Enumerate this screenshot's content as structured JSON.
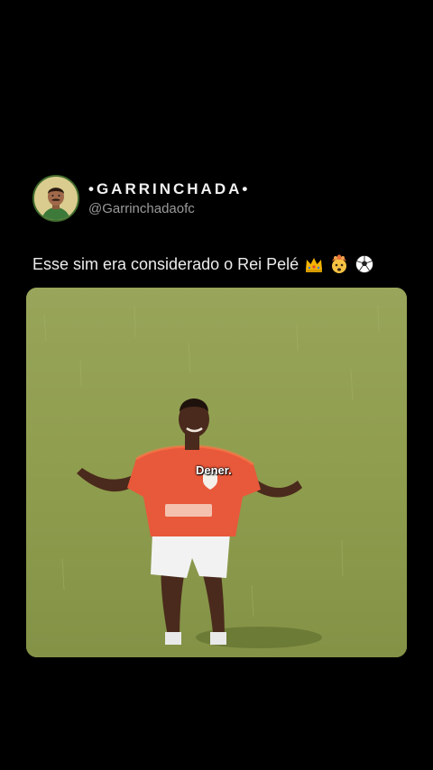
{
  "post": {
    "display_name": "•GARRINCHADA•",
    "handle": "@Garrinchadaofc",
    "text": "Esse sim era considerado o Rei Pelé",
    "emojis": [
      "crown-icon",
      "exploding-head-icon",
      "soccer-ball-icon"
    ]
  },
  "media": {
    "caption": "Dener."
  },
  "colors": {
    "background": "#000000",
    "text": "#ececec",
    "handle": "#9a9a9a",
    "field": "#8f9b4e",
    "jersey": "#e8583a",
    "avatar_border": "#3f6b2c"
  }
}
